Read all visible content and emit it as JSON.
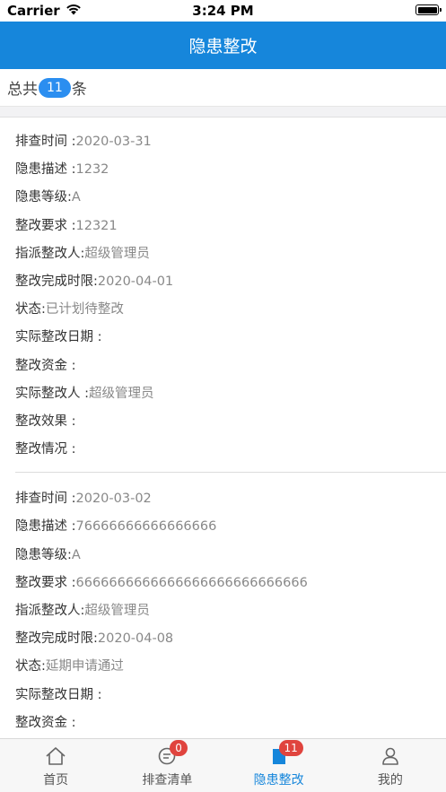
{
  "status_bar": {
    "carrier": "Carrier",
    "time": "3:24 PM"
  },
  "nav": {
    "title": "隐患整改"
  },
  "summary": {
    "prefix": "总共",
    "count": "11",
    "suffix": "条"
  },
  "records": [
    {
      "fields": [
        {
          "label": "排查时间 :",
          "value": "2020-03-31"
        },
        {
          "label": "隐患描述 :",
          "value": "1232"
        },
        {
          "label": "隐患等级:",
          "value": "A"
        },
        {
          "label": "整改要求 :",
          "value": "12321"
        },
        {
          "label": "指派整改人:",
          "value": "超级管理员"
        },
        {
          "label": "整改完成时限:",
          "value": "2020-04-01"
        },
        {
          "label": "状态:",
          "value": "已计划待整改"
        },
        {
          "label": "实际整改日期 :",
          "value": ""
        },
        {
          "label": "整改资金 :",
          "value": ""
        },
        {
          "label": "实际整改人 :",
          "value": "超级管理员"
        },
        {
          "label": "整改效果 :",
          "value": ""
        },
        {
          "label": "整改情况 :",
          "value": ""
        }
      ]
    },
    {
      "fields": [
        {
          "label": "排查时间 :",
          "value": "2020-03-02"
        },
        {
          "label": "隐患描述 :",
          "value": "76666666666666666"
        },
        {
          "label": "隐患等级:",
          "value": "A"
        },
        {
          "label": "整改要求 :",
          "value": "6666666666666666666666666666"
        },
        {
          "label": "指派整改人:",
          "value": "超级管理员"
        },
        {
          "label": "整改完成时限:",
          "value": "2020-04-08"
        },
        {
          "label": "状态:",
          "value": "延期申请通过"
        },
        {
          "label": "实际整改日期 :",
          "value": ""
        },
        {
          "label": "整改资金 :",
          "value": ""
        }
      ]
    }
  ],
  "tabs": [
    {
      "label": "首页",
      "icon": "home-icon",
      "badge": null,
      "active": false
    },
    {
      "label": "排查清单",
      "icon": "checklist-icon",
      "badge": "0",
      "active": false
    },
    {
      "label": "隐患整改",
      "icon": "rectify-icon",
      "badge": "11",
      "active": true
    },
    {
      "label": "我的",
      "icon": "profile-icon",
      "badge": null,
      "active": false
    }
  ],
  "colors": {
    "primary": "#1686db",
    "badge": "#e0443e",
    "pill": "#2b8ef0"
  }
}
